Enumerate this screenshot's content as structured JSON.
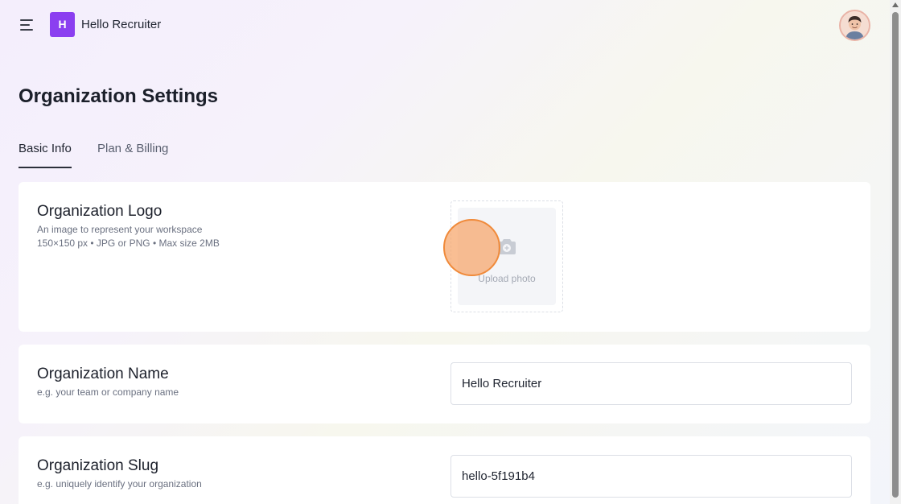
{
  "header": {
    "brand_initial": "H",
    "brand_name": "Hello Recruiter",
    "menu_icon": "hamburger-menu-icon",
    "avatar_icon": "user-avatar"
  },
  "page": {
    "title": "Organization Settings"
  },
  "tabs": [
    {
      "label": "Basic Info",
      "active": true
    },
    {
      "label": "Plan & Billing",
      "active": false
    }
  ],
  "logo_section": {
    "title": "Organization Logo",
    "description": "An image to represent your workspace",
    "requirements": "150×150 px • JPG or PNG • Max size 2MB",
    "upload_label": "Upload photo",
    "upload_icon": "camera-plus-icon"
  },
  "name_section": {
    "title": "Organization Name",
    "description": "e.g. your team or company name",
    "value": "Hello Recruiter"
  },
  "slug_section": {
    "title": "Organization Slug",
    "description": "e.g. uniquely identify your organization",
    "value": "hello-5f191b4"
  },
  "colors": {
    "brand": "#8b3ff0",
    "cursor_highlight": "#f6a569"
  }
}
